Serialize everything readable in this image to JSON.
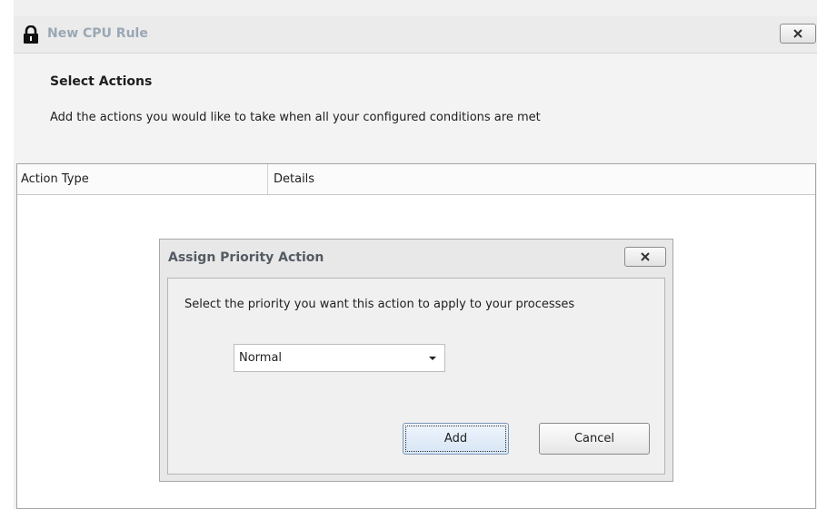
{
  "window": {
    "title": "New CPU Rule",
    "lock_icon": "lock-icon",
    "close_icon": "close-x-icon"
  },
  "header": {
    "title": "Select Actions",
    "description": "Add the actions you would like to take when all your configured conditions are met"
  },
  "grid": {
    "columns": [
      "Action Type",
      "Details"
    ],
    "rows": []
  },
  "dialog": {
    "title": "Assign Priority Action",
    "close_icon": "close-x-icon",
    "prompt": "Select the priority you want this action to apply to your processes",
    "priority_select": {
      "value": "Normal"
    },
    "add_label": "Add",
    "cancel_label": "Cancel"
  }
}
